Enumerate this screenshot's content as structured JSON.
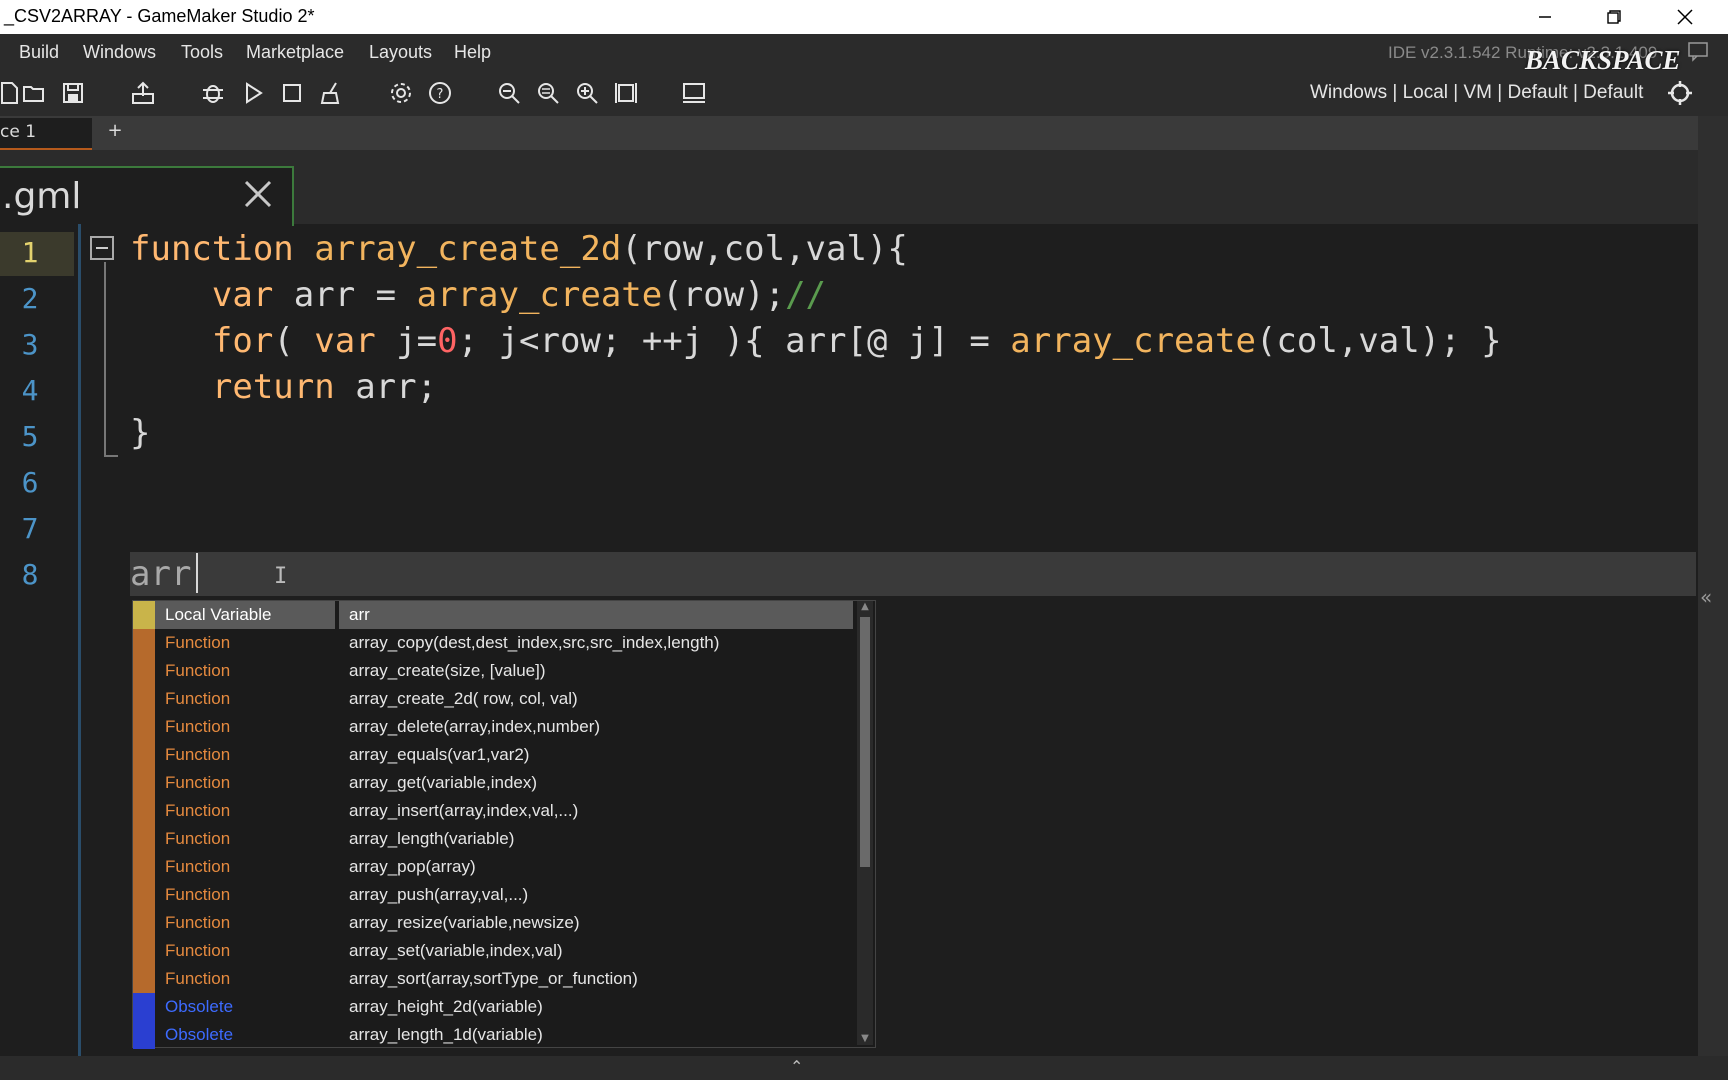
{
  "window": {
    "title": "_CSV2ARRAY - GameMaker Studio 2*"
  },
  "menu": {
    "items": [
      "Build",
      "Windows",
      "Tools",
      "Marketplace",
      "Layouts",
      "Help"
    ],
    "ide_version": "IDE v2.3.1.542  Runtime: v2.3.1.409"
  },
  "overlay": {
    "key_label": "BACKSPACE"
  },
  "toolbar": {
    "target": "Windows | Local | VM | Default | Default",
    "icons": [
      "new-file-icon",
      "open-folder-icon",
      "save-icon",
      "export-icon",
      "debug-icon",
      "play-icon",
      "stop-icon",
      "clean-icon",
      "settings-gear-icon",
      "help-icon",
      "zoom-out-icon",
      "zoom-reset-icon",
      "zoom-in-icon",
      "fit-icon",
      "device-icon",
      "target-icon"
    ]
  },
  "workspace": {
    "tab_label": "ce 1",
    "add_label": "+"
  },
  "editor": {
    "file_tab": ".gml",
    "line_numbers": [
      "1",
      "2",
      "3",
      "4",
      "5",
      "6",
      "7",
      "8"
    ],
    "current_input": "arr"
  },
  "autocomplete": {
    "rows": [
      {
        "type": "Local Variable",
        "sig": "arr",
        "kind": "local"
      },
      {
        "type": "Function",
        "sig": "array_copy(dest,dest_index,src,src_index,length)",
        "kind": "function"
      },
      {
        "type": "Function",
        "sig": "array_create(size, [value])",
        "kind": "function"
      },
      {
        "type": "Function",
        "sig": "array_create_2d( row, col, val)",
        "kind": "function"
      },
      {
        "type": "Function",
        "sig": "array_delete(array,index,number)",
        "kind": "function"
      },
      {
        "type": "Function",
        "sig": "array_equals(var1,var2)",
        "kind": "function"
      },
      {
        "type": "Function",
        "sig": "array_get(variable,index)",
        "kind": "function"
      },
      {
        "type": "Function",
        "sig": "array_insert(array,index,val,...)",
        "kind": "function"
      },
      {
        "type": "Function",
        "sig": "array_length(variable)",
        "kind": "function"
      },
      {
        "type": "Function",
        "sig": "array_pop(array)",
        "kind": "function"
      },
      {
        "type": "Function",
        "sig": "array_push(array,val,...)",
        "kind": "function"
      },
      {
        "type": "Function",
        "sig": "array_resize(variable,newsize)",
        "kind": "function"
      },
      {
        "type": "Function",
        "sig": "array_set(variable,index,val)",
        "kind": "function"
      },
      {
        "type": "Function",
        "sig": "array_sort(array,sortType_or_function)",
        "kind": "function"
      },
      {
        "type": "Obsolete",
        "sig": "array_height_2d(variable)",
        "kind": "obsolete"
      },
      {
        "type": "Obsolete",
        "sig": "array_length_1d(variable)",
        "kind": "obsolete"
      }
    ]
  },
  "colors": {
    "local_swatch": "#c9b44a",
    "function_swatch": "#b66a2c",
    "function_text": "#e58a3f",
    "obsolete_swatch": "#2a3fd1",
    "obsolete_text": "#3d6bff",
    "local_text": "#ffffff"
  }
}
